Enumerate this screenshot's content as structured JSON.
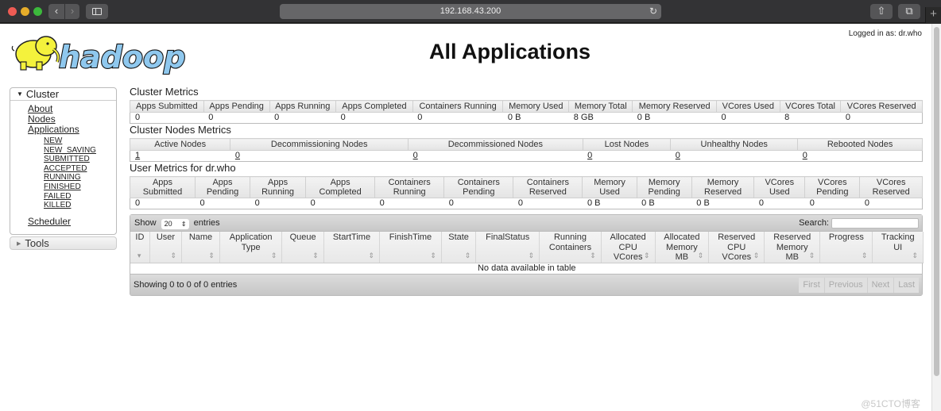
{
  "browser": {
    "url": "192.168.43.200",
    "new_tab_label": "+"
  },
  "header": {
    "title": "All Applications",
    "logged_in": "Logged in as: dr.who",
    "logo_text": "hadoop"
  },
  "sidebar": {
    "cluster_label": "Cluster",
    "links": [
      "About",
      "Nodes",
      "Applications"
    ],
    "app_states": [
      "NEW",
      "NEW_SAVING",
      "SUBMITTED",
      "ACCEPTED",
      "RUNNING",
      "FINISHED",
      "FAILED",
      "KILLED"
    ],
    "scheduler": "Scheduler",
    "tools_label": "Tools"
  },
  "cluster_metrics": {
    "title": "Cluster Metrics",
    "headers": [
      "Apps Submitted",
      "Apps Pending",
      "Apps Running",
      "Apps Completed",
      "Containers Running",
      "Memory Used",
      "Memory Total",
      "Memory Reserved",
      "VCores Used",
      "VCores Total",
      "VCores Reserved"
    ],
    "values": [
      "0",
      "0",
      "0",
      "0",
      "0",
      "0 B",
      "8 GB",
      "0 B",
      "0",
      "8",
      "0"
    ]
  },
  "cluster_nodes_metrics": {
    "title": "Cluster Nodes Metrics",
    "headers": [
      "Active Nodes",
      "Decommissioning Nodes",
      "Decommissioned Nodes",
      "Lost Nodes",
      "Unhealthy Nodes",
      "Rebooted Nodes"
    ],
    "values": [
      "1",
      "0",
      "0",
      "0",
      "0",
      "0"
    ]
  },
  "user_metrics": {
    "title": "User Metrics for dr.who",
    "headers": [
      [
        "Apps",
        "Submitted"
      ],
      [
        "Apps",
        "Pending"
      ],
      [
        "Apps",
        "Running"
      ],
      [
        "Apps",
        "Completed"
      ],
      [
        "Containers",
        "Running"
      ],
      [
        "Containers",
        "Pending"
      ],
      [
        "Containers",
        "Reserved"
      ],
      [
        "Memory",
        "Used"
      ],
      [
        "Memory",
        "Pending"
      ],
      [
        "Memory",
        "Reserved"
      ],
      [
        "VCores",
        "Used"
      ],
      [
        "VCores",
        "Pending"
      ],
      [
        "VCores",
        "Reserved"
      ]
    ],
    "values": [
      "0",
      "0",
      "0",
      "0",
      "0",
      "0",
      "0",
      "0 B",
      "0 B",
      "0 B",
      "0",
      "0",
      "0"
    ]
  },
  "apps_table": {
    "show_label": "Show",
    "page_size": "20",
    "entries_label": "entries",
    "search_label": "Search:",
    "search_value": "",
    "columns": [
      [
        "ID"
      ],
      [
        "User"
      ],
      [
        "Name"
      ],
      [
        "Application",
        "Type"
      ],
      [
        "Queue"
      ],
      [
        "StartTime"
      ],
      [
        "FinishTime"
      ],
      [
        "State"
      ],
      [
        "FinalStatus"
      ],
      [
        "Running",
        "Containers"
      ],
      [
        "Allocated",
        "CPU",
        "VCores"
      ],
      [
        "Allocated",
        "Memory",
        "MB"
      ],
      [
        "Reserved",
        "CPU",
        "VCores"
      ],
      [
        "Reserved",
        "Memory",
        "MB"
      ],
      [
        "Progress"
      ],
      [
        "Tracking",
        "UI"
      ]
    ],
    "empty_message": "No data available in table",
    "info": "Showing 0 to 0 of 0 entries",
    "pager": [
      "First",
      "Previous",
      "Next",
      "Last"
    ]
  },
  "watermark": "@51CTO博客"
}
